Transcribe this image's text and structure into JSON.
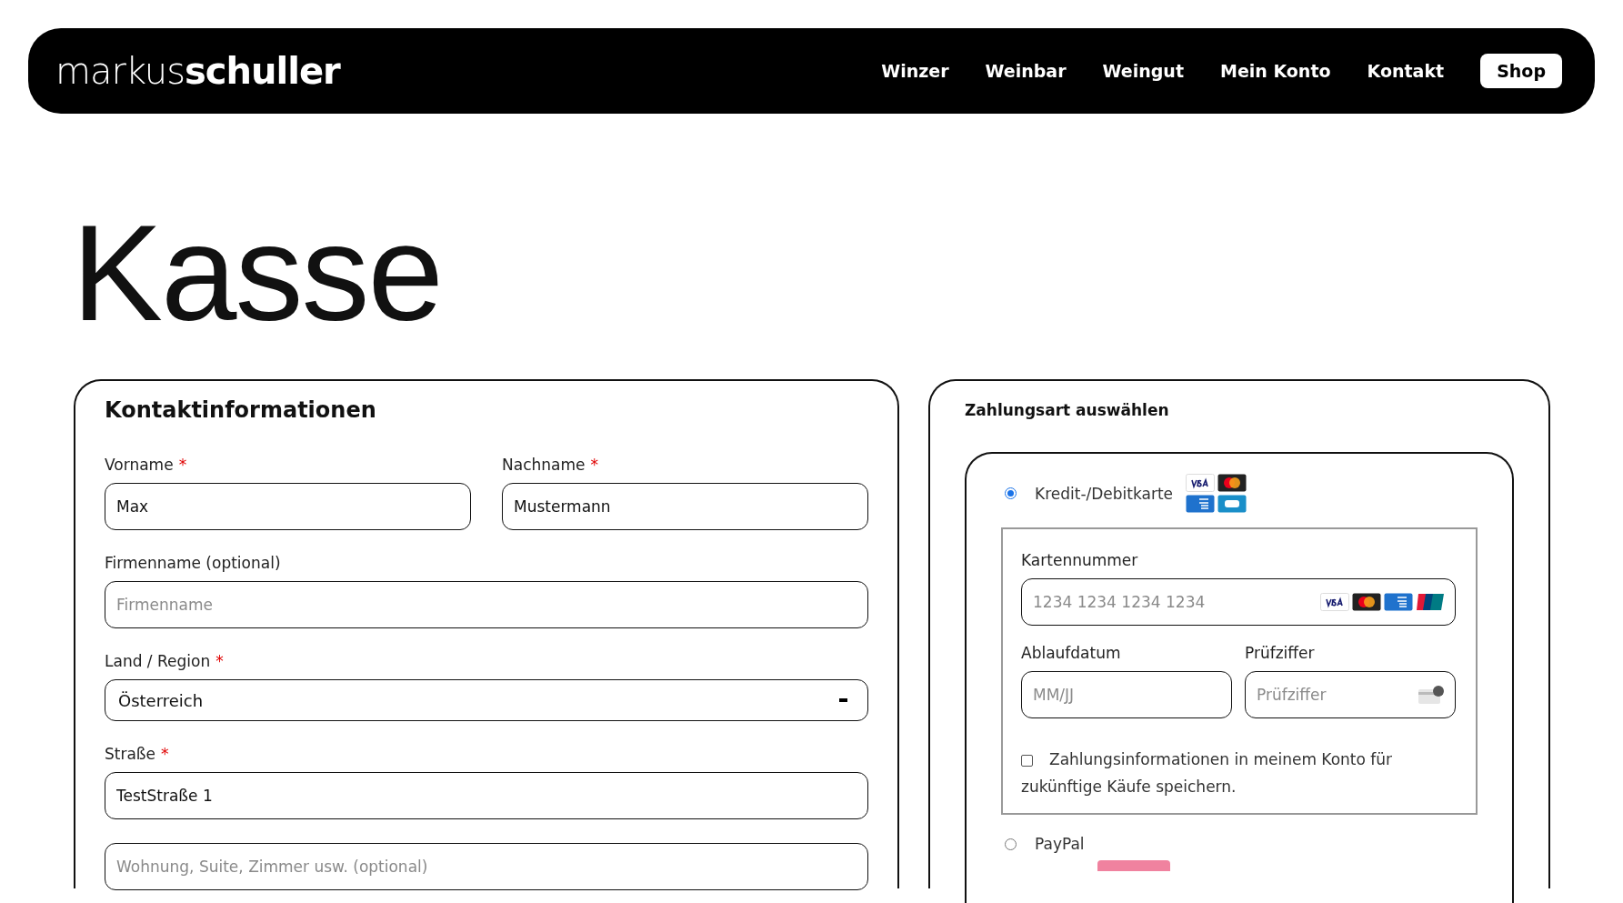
{
  "header": {
    "logo": "markus**schuller**",
    "nav": [
      {
        "label": "Winzer",
        "kind": "link"
      },
      {
        "label": "Weinbar",
        "kind": "link"
      },
      {
        "label": "Weingut",
        "kind": "link"
      },
      {
        "label": "Mein Konto",
        "kind": "link"
      },
      {
        "label": "Kontakt",
        "kind": "link"
      },
      {
        "label": "Shop",
        "kind": "button"
      }
    ]
  },
  "page_title": "Kasse",
  "contact": {
    "title": "Kontaktinformationen",
    "required_mark": "*",
    "rows": [
      [
        {
          "label": "Vorname",
          "required": true,
          "value": "Max",
          "kind": "text"
        },
        {
          "label": "Nachname",
          "required": true,
          "value": "Mustermann",
          "kind": "text"
        }
      ],
      [
        {
          "label": "Firmenname (optional)",
          "required": false,
          "placeholder": "Firmenname",
          "kind": "text"
        }
      ],
      [
        {
          "label": "Land / Region",
          "required": true,
          "value": "Österreich",
          "kind": "select"
        }
      ],
      [
        {
          "label": "Straße",
          "required": true,
          "value": "TestStraße 1",
          "kind": "text"
        }
      ],
      [
        {
          "placeholder": "Wohnung, Suite, Zimmer usw. (optional)",
          "kind": "text"
        }
      ]
    ]
  },
  "payment": {
    "title": "Zahlungsart auswählen",
    "methods": [
      {
        "label": "Kredit-/Debitkarte",
        "selected": true,
        "kind": "card",
        "details": {
          "number_label": "Kartennummer",
          "number_placeholder": "1234 1234 1234 1234",
          "expiry_label": "Ablaufdatum",
          "expiry_placeholder": "MM/JJ",
          "cvc_label": "Prüfziffer",
          "cvc_placeholder": "Prüfziffer",
          "save": {
            "label": "Zahlungsinformationen in meinem Konto für zukünftige Käufe speichern.",
            "checked": false
          }
        }
      },
      {
        "label": "PayPal",
        "selected": false,
        "kind": "paypal"
      }
    ]
  }
}
